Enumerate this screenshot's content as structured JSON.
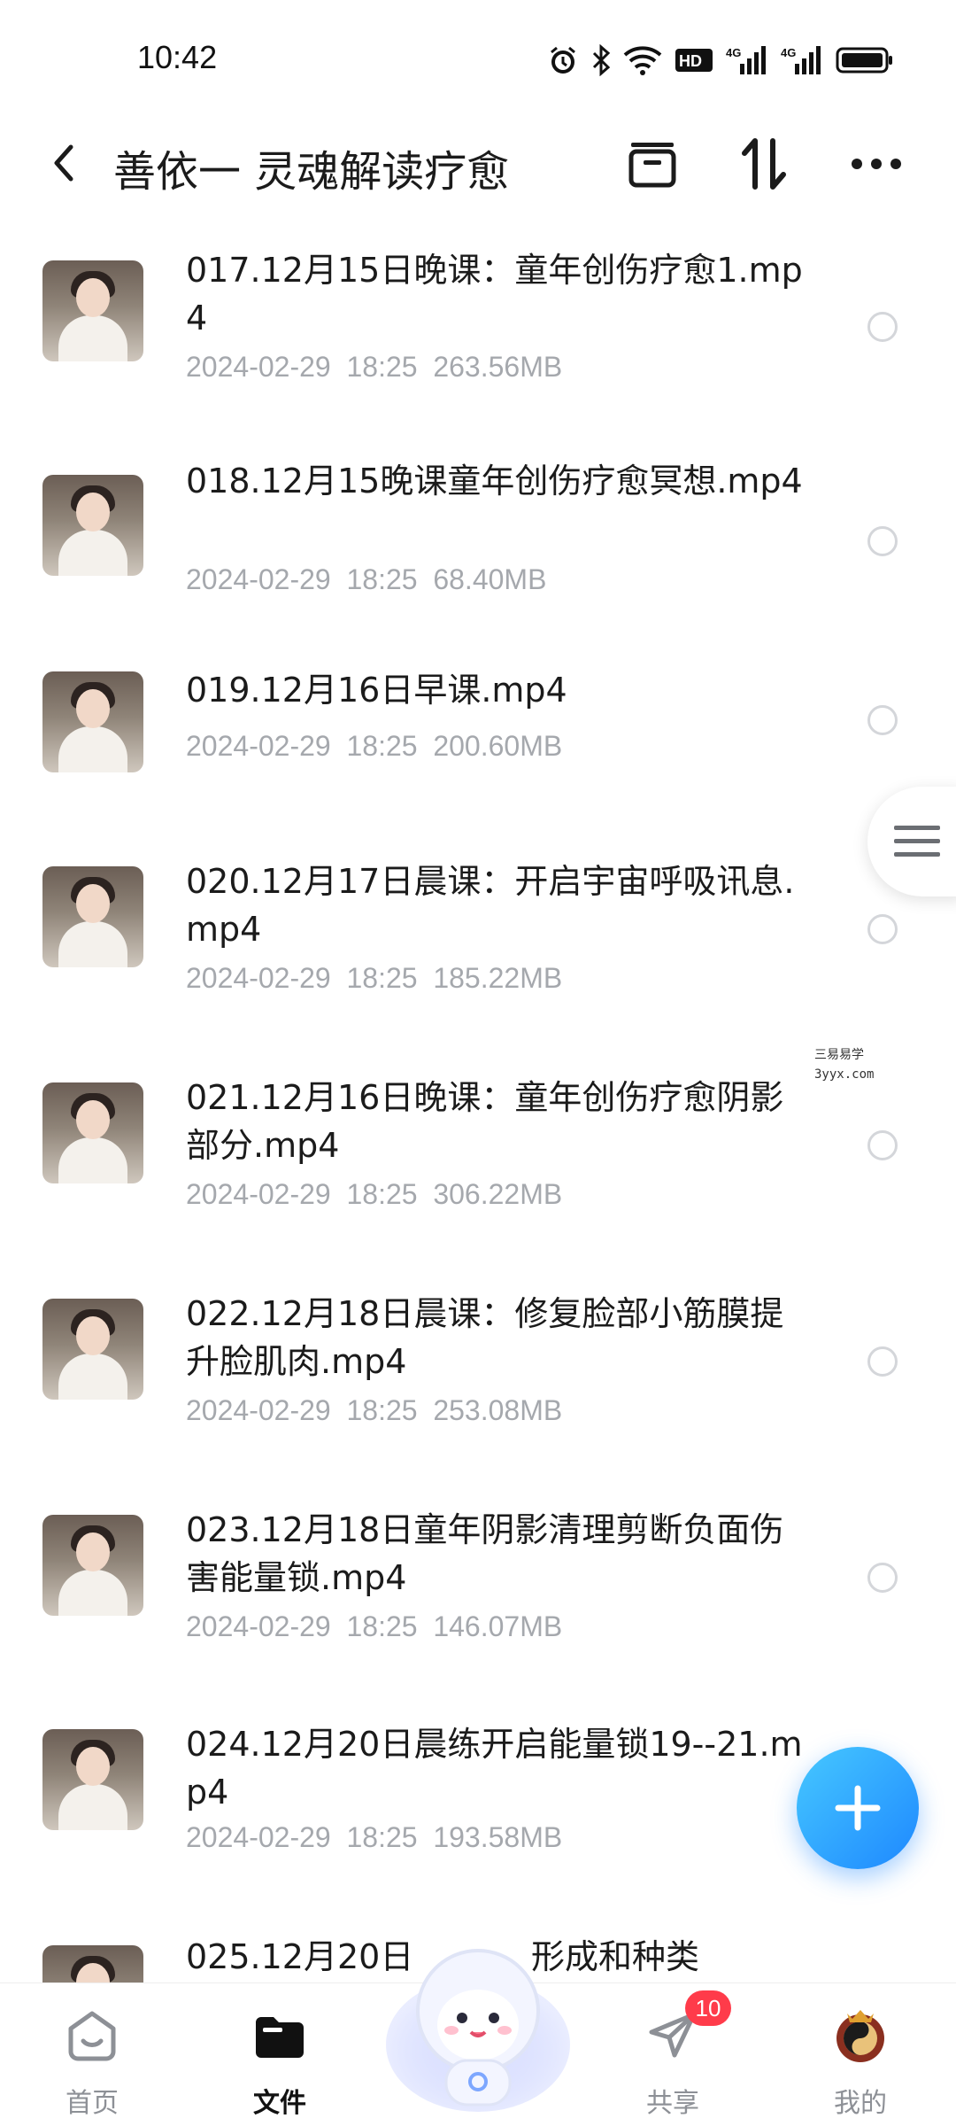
{
  "status_bar": {
    "time": "10:42",
    "icons": [
      "alarm-icon",
      "bluetooth-icon",
      "wifi-icon",
      "hd-icon",
      "signal-4g-icon",
      "signal-4g-icon",
      "battery-icon"
    ],
    "hd_label": "HD",
    "network_label": "4G"
  },
  "header": {
    "title": "善依一 灵魂解读疗愈",
    "icons": [
      "back-arrow-icon",
      "archive-icon",
      "sort-icon",
      "more-icon"
    ]
  },
  "files": [
    {
      "name": "017.12月15日晚课：童年创伤疗愈1.mp4",
      "date": "2024-02-29",
      "time": "18:25",
      "size": "263.56MB"
    },
    {
      "name": "018.12月15晚课童年创伤疗愈冥想.mp4",
      "date": "2024-02-29",
      "time": "18:25",
      "size": "68.40MB"
    },
    {
      "name": "019.12月16日早课.mp4",
      "date": "2024-02-29",
      "time": "18:25",
      "size": "200.60MB"
    },
    {
      "name": "020.12月17日晨课：开启宇宙呼吸讯息.mp4",
      "date": "2024-02-29",
      "time": "18:25",
      "size": "185.22MB"
    },
    {
      "name": "021.12月16日晚课：童年创伤疗愈阴影部分.mp4",
      "date": "2024-02-29",
      "time": "18:25",
      "size": "306.22MB"
    },
    {
      "name": "022.12月18日晨课：修复脸部小筋膜提升脸肌肉.mp4",
      "date": "2024-02-29",
      "time": "18:25",
      "size": "253.08MB"
    },
    {
      "name": "023.12月18日童年阴影清理剪断负面伤害能量锁.mp4",
      "date": "2024-02-29",
      "time": "18:25",
      "size": "146.07MB"
    },
    {
      "name": "024.12月20日晨练开启能量锁19--21.mp4",
      "date": "2024-02-29",
      "time": "18:25",
      "size": "193.58MB"
    },
    {
      "name": "025.12月20日",
      "name_tail": "形成和种类",
      "date": "",
      "time": "",
      "size": ""
    }
  ],
  "watermark": {
    "line1": "三易易学",
    "line2": "3yyx.com"
  },
  "fab": {
    "icon": "plus-icon"
  },
  "bottom_nav": {
    "items": [
      {
        "label": "首页",
        "icon": "home-icon",
        "active": false
      },
      {
        "label": "文件",
        "icon": "folder-icon",
        "active": true
      },
      {
        "label": "",
        "icon": "mascot-icon",
        "active": false
      },
      {
        "label": "共享",
        "icon": "share-plane-icon",
        "active": false,
        "badge": "10"
      },
      {
        "label": "我的",
        "icon": "profile-avatar-icon",
        "active": false
      }
    ]
  },
  "colors": {
    "accent": "#1E88FF",
    "badge": "#FF3B4A",
    "meta_text": "#A5A8AD",
    "radio_border": "#D4D6DA"
  }
}
